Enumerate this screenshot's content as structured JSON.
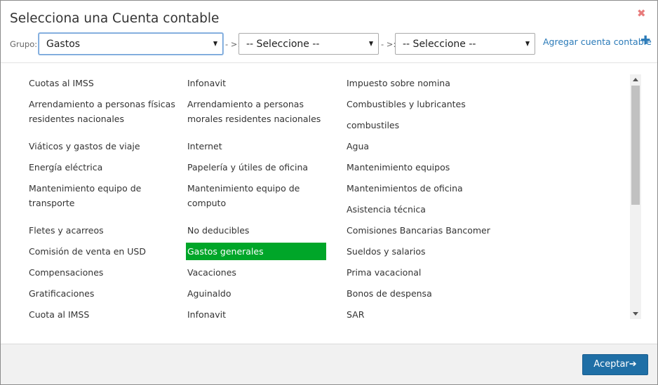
{
  "dialog": {
    "title": "Selecciona una Cuenta contable",
    "close_icon": "✖"
  },
  "toolbar": {
    "group_label": "Grupo:",
    "group_value": "Gastos",
    "sep1": "- >:",
    "select2_value": "-- Seleccione --",
    "sep2": "- >:",
    "select3_value": "-- Seleccione --",
    "add_link": "Agregar cuenta contable",
    "plus_icon": "✚"
  },
  "columns": {
    "col1": [
      "Cuotas al IMSS",
      "Arrendamiento a personas físicas",
      "residentes nacionales",
      "",
      "Viáticos y gastos de viaje",
      "Energía eléctrica",
      "Mantenimiento equipo de",
      "transporte",
      "",
      "Fletes y acarreos",
      "Comisión de venta en USD",
      "Compensaciones",
      "Gratificaciones",
      "Cuota al IMSS"
    ],
    "col2": [
      "Infonavit",
      "Arrendamiento a personas",
      "morales residentes nacionales",
      "",
      "Internet",
      "Papelería y útiles de oficina",
      "Mantenimiento equipo de",
      "computo",
      "",
      "No deducibles",
      "Gastos generales",
      "Vacaciones",
      "Aguinaldo",
      "Infonavit"
    ],
    "col3": [
      "Impuesto sobre nomina",
      "Combustibles y lubricantes",
      "",
      "combustiles",
      "Agua",
      "Mantenimiento equipos",
      "Mantenimientos de oficina",
      "",
      "Asistencia técnica",
      "Comisiones Bancarias Bancomer",
      "Sueldos y salarios",
      "Prima vacacional",
      "Bonos de despensa",
      "SAR"
    ]
  },
  "selected_item": "Gastos generales",
  "colors": {
    "selected_bg": "#00a629",
    "link": "#2a7ab8",
    "primary_button": "#1f6fa6",
    "close": "#e87c7c"
  },
  "footer": {
    "ok_label": "Aceptar",
    "ok_icon": "➔"
  }
}
